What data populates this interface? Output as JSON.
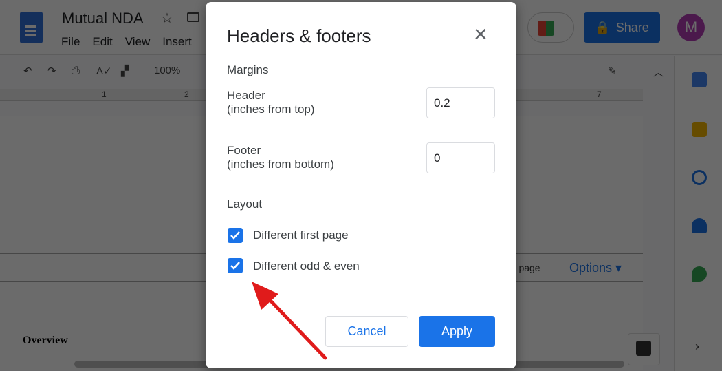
{
  "app": {
    "title": "Mutual NDA",
    "menu": [
      "File",
      "Edit",
      "View",
      "Insert"
    ],
    "share_label": "Share",
    "avatar_initial": "M",
    "zoom": "100%",
    "ruler_labels": [
      "1",
      "2",
      "7"
    ],
    "header_bar": {
      "first_page_text": "rst page",
      "options_label": "Options"
    },
    "doc_text": "Overview"
  },
  "dialog": {
    "title": "Headers & footers",
    "margins_label": "Margins",
    "header_label": "Header",
    "header_sub": "(inches from top)",
    "header_value": "0.2",
    "footer_label": "Footer",
    "footer_sub": "(inches from bottom)",
    "footer_value": "0",
    "layout_label": "Layout",
    "checkboxes": [
      {
        "label": "Different first page",
        "checked": true
      },
      {
        "label": "Different odd & even",
        "checked": true
      }
    ],
    "cancel_label": "Cancel",
    "apply_label": "Apply"
  },
  "colors": {
    "accent": "#1a73e8",
    "annotation_arrow": "#e01b1b"
  }
}
